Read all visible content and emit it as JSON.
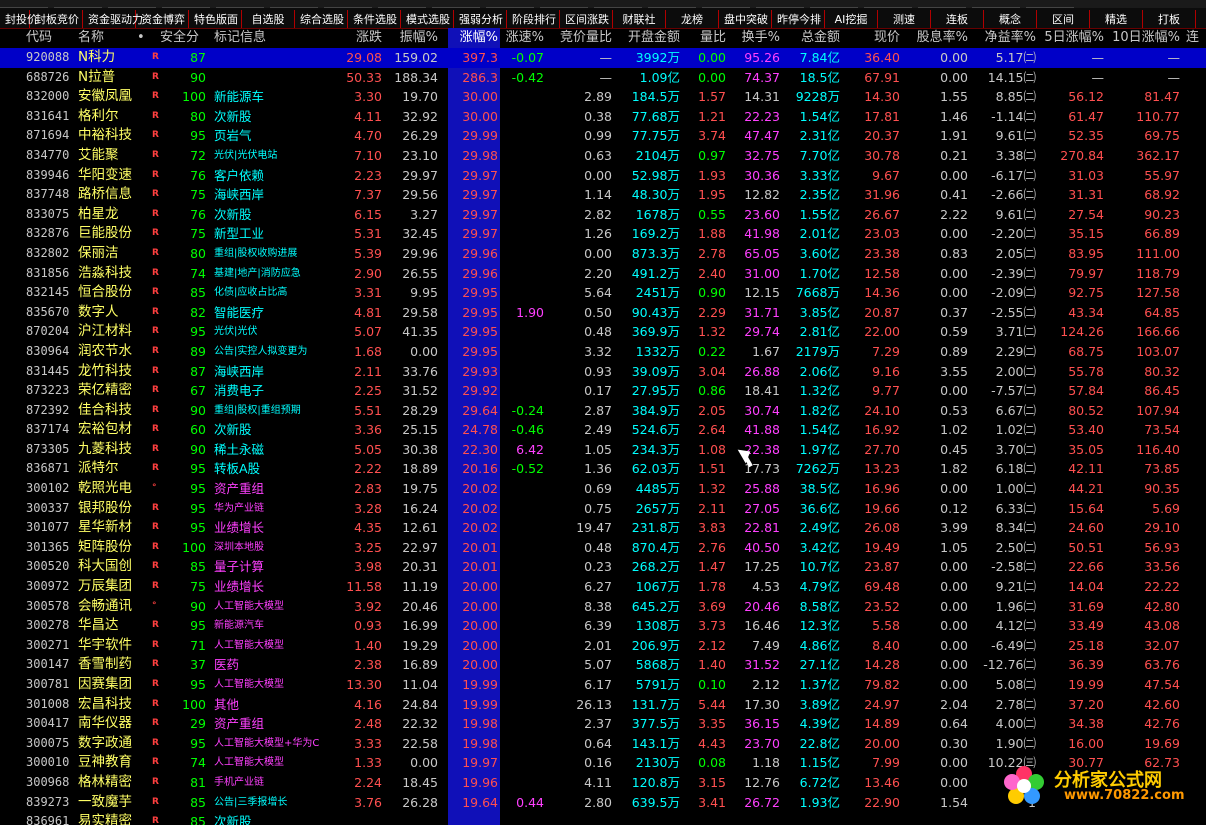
{
  "toolbar_count": 20,
  "tabs": [
    "封投价",
    "封板竞价",
    "资金驱动力",
    "资金博弈",
    "特色版面",
    "自选股",
    "综合选股",
    "条件选股",
    "模式选股",
    "强弱分析",
    "阶段排行",
    "区间涨跌",
    "财联社",
    "龙榜",
    "盘中突破",
    "昨停今排",
    "AI挖掘",
    "测速",
    "连板",
    "概念",
    "区间",
    "精选",
    "打板"
  ],
  "headers": {
    "code": "代码",
    "name": "名称",
    "star": "•",
    "score": "安全分",
    "tag": "标记信息",
    "chg": "涨跌",
    "amp": "振幅%",
    "pct": "涨幅%",
    "speed": "涨速%",
    "bidratio": "竞价量比",
    "openamt": "开盘金额",
    "volratio": "量比",
    "turn": "换手%",
    "total": "总金额",
    "price": "现价",
    "div": "股息率%",
    "pe": "净益率%",
    "d5": "5日涨幅%",
    "d10": "10日涨幅%",
    "extra": "连"
  },
  "rows": [
    {
      "code": "920088",
      "name": "N科力",
      "r": "R",
      "score": "87",
      "tag": "",
      "chg": "29.08",
      "amp": "159.02",
      "pct": "397.3",
      "speed": "-0.07",
      "bidratio": "—",
      "openamt": "3992万",
      "volratio": "0.00",
      "turn": "95.26",
      "total": "7.84亿",
      "price": "36.40",
      "div": "0.00",
      "pe": "5.17㈡",
      "d5": "—",
      "d10": "—"
    },
    {
      "code": "688726",
      "name": "N拉普",
      "r": "R",
      "score": "90",
      "tag": "",
      "chg": "50.33",
      "amp": "188.34",
      "pct": "286.3",
      "speed": "-0.42",
      "bidratio": "—",
      "openamt": "1.09亿",
      "volratio": "0.00",
      "turn": "74.37",
      "total": "18.5亿",
      "price": "67.91",
      "div": "0.00",
      "pe": "14.15㈡",
      "d5": "—",
      "d10": "—"
    },
    {
      "code": "832000",
      "name": "安徽凤凰",
      "r": "R",
      "score": "100",
      "tag": "新能源车",
      "chg": "3.30",
      "amp": "19.70",
      "pct": "30.00",
      "speed": "",
      "bidratio": "2.89",
      "openamt": "184.5万",
      "volratio": "1.57",
      "turn": "14.31",
      "total": "9228万",
      "price": "14.30",
      "div": "1.55",
      "pe": "8.85㈡",
      "d5": "56.12",
      "d10": "81.47"
    },
    {
      "code": "831641",
      "name": "格利尔",
      "r": "R",
      "score": "80",
      "tag": "次新股",
      "chg": "4.11",
      "amp": "32.92",
      "pct": "30.00",
      "speed": "",
      "bidratio": "0.38",
      "openamt": "77.68万",
      "volratio": "1.21",
      "turn": "22.23",
      "total": "1.54亿",
      "price": "17.81",
      "div": "1.46",
      "pe": "-1.14㈡",
      "d5": "61.47",
      "d10": "110.77"
    },
    {
      "code": "871694",
      "name": "中裕科技",
      "r": "R",
      "score": "95",
      "tag": "页岩气",
      "chg": "4.70",
      "amp": "26.29",
      "pct": "29.99",
      "speed": "",
      "bidratio": "0.99",
      "openamt": "77.75万",
      "volratio": "3.74",
      "turn": "47.47",
      "total": "2.31亿",
      "price": "20.37",
      "div": "1.91",
      "pe": "9.61㈡",
      "d5": "52.35",
      "d10": "69.75"
    },
    {
      "code": "834770",
      "name": "艾能聚",
      "r": "R",
      "score": "72",
      "tag": "光伏|光伏电站",
      "small": true,
      "chg": "7.10",
      "amp": "23.10",
      "pct": "29.98",
      "speed": "",
      "bidratio": "0.63",
      "openamt": "2104万",
      "volratio": "0.97",
      "turn": "32.75",
      "total": "7.70亿",
      "price": "30.78",
      "div": "0.21",
      "pe": "3.38㈡",
      "d5": "270.84",
      "d10": "362.17"
    },
    {
      "code": "839946",
      "name": "华阳变速",
      "r": "R",
      "score": "76",
      "tag": "客户依赖",
      "chg": "2.23",
      "amp": "29.97",
      "pct": "29.97",
      "speed": "",
      "bidratio": "0.00",
      "openamt": "52.98万",
      "volratio": "1.93",
      "turn": "30.36",
      "total": "3.33亿",
      "price": "9.67",
      "div": "0.00",
      "pe": "-6.17㈡",
      "d5": "31.03",
      "d10": "55.97"
    },
    {
      "code": "837748",
      "name": "路桥信息",
      "r": "R",
      "score": "75",
      "tag": "海峡西岸",
      "chg": "7.37",
      "amp": "29.56",
      "pct": "29.97",
      "speed": "",
      "bidratio": "1.14",
      "openamt": "48.30万",
      "volratio": "1.95",
      "turn": "12.82",
      "total": "2.35亿",
      "price": "31.96",
      "div": "0.41",
      "pe": "-2.66㈡",
      "d5": "31.31",
      "d10": "68.92"
    },
    {
      "code": "833075",
      "name": "柏星龙",
      "r": "R",
      "score": "76",
      "tag": "次新股",
      "chg": "6.15",
      "amp": "3.27",
      "pct": "29.97",
      "speed": "",
      "bidratio": "2.82",
      "openamt": "1678万",
      "volratio": "0.55",
      "turn": "23.60",
      "total": "1.55亿",
      "price": "26.67",
      "div": "2.22",
      "pe": "9.61㈡",
      "d5": "27.54",
      "d10": "90.23"
    },
    {
      "code": "832876",
      "name": "巨能股份",
      "r": "R",
      "score": "75",
      "tag": "新型工业",
      "chg": "5.31",
      "amp": "32.45",
      "pct": "29.97",
      "speed": "",
      "bidratio": "1.26",
      "openamt": "169.2万",
      "volratio": "1.88",
      "turn": "41.98",
      "total": "2.01亿",
      "price": "23.03",
      "div": "0.00",
      "pe": "-2.20㈡",
      "d5": "35.15",
      "d10": "66.89"
    },
    {
      "code": "832802",
      "name": "保丽洁",
      "r": "R",
      "score": "80",
      "tag": "重组|股权收购进展",
      "small": true,
      "chg": "5.39",
      "amp": "29.96",
      "pct": "29.96",
      "speed": "",
      "bidratio": "0.00",
      "openamt": "873.3万",
      "volratio": "2.78",
      "turn": "65.05",
      "total": "3.60亿",
      "price": "23.38",
      "div": "0.83",
      "pe": "2.05㈡",
      "d5": "83.95",
      "d10": "111.00"
    },
    {
      "code": "831856",
      "name": "浩淼科技",
      "r": "R",
      "score": "74",
      "tag": "基建|地产|消防应急",
      "small": true,
      "chg": "2.90",
      "amp": "26.55",
      "pct": "29.96",
      "speed": "",
      "bidratio": "2.20",
      "openamt": "491.2万",
      "volratio": "2.40",
      "turn": "31.00",
      "total": "1.70亿",
      "price": "12.58",
      "div": "0.00",
      "pe": "-2.39㈡",
      "d5": "79.97",
      "d10": "118.79"
    },
    {
      "code": "832145",
      "name": "恒合股份",
      "r": "R",
      "score": "85",
      "tag": "化债|应收占比高",
      "small": true,
      "chg": "3.31",
      "amp": "9.95",
      "pct": "29.95",
      "speed": "",
      "bidratio": "5.64",
      "openamt": "2451万",
      "volratio": "0.90",
      "turn": "12.15",
      "total": "7668万",
      "price": "14.36",
      "div": "0.00",
      "pe": "-2.09㈡",
      "d5": "92.75",
      "d10": "127.58"
    },
    {
      "code": "835670",
      "name": "数字人",
      "r": "R",
      "score": "82",
      "tag": "智能医疗",
      "chg": "4.81",
      "amp": "29.58",
      "pct": "29.95",
      "speed": "1.90",
      "bidratio": "0.50",
      "openamt": "90.43万",
      "volratio": "2.29",
      "turn": "31.71",
      "total": "3.85亿",
      "price": "20.87",
      "div": "0.37",
      "pe": "-2.55㈡",
      "d5": "43.34",
      "d10": "64.85"
    },
    {
      "code": "870204",
      "name": "沪江材料",
      "r": "R",
      "score": "95",
      "tag": "光伏|光伏",
      "small": true,
      "chg": "5.07",
      "amp": "41.35",
      "pct": "29.95",
      "speed": "",
      "bidratio": "0.48",
      "openamt": "369.9万",
      "volratio": "1.32",
      "turn": "29.74",
      "total": "2.81亿",
      "price": "22.00",
      "div": "0.59",
      "pe": "3.71㈡",
      "d5": "124.26",
      "d10": "166.66"
    },
    {
      "code": "830964",
      "name": "润农节水",
      "r": "R",
      "score": "89",
      "tag": "公告|实控人拟变更为",
      "small": true,
      "chg": "1.68",
      "amp": "0.00",
      "pct": "29.95",
      "speed": "",
      "bidratio": "3.32",
      "openamt": "1332万",
      "volratio": "0.22",
      "turn": "1.67",
      "total": "2179万",
      "price": "7.29",
      "div": "0.89",
      "pe": "2.29㈡",
      "d5": "68.75",
      "d10": "103.07"
    },
    {
      "code": "831445",
      "name": "龙竹科技",
      "r": "R",
      "score": "87",
      "tag": "海峡西岸",
      "chg": "2.11",
      "amp": "33.76",
      "pct": "29.93",
      "speed": "",
      "bidratio": "0.93",
      "openamt": "39.09万",
      "volratio": "3.04",
      "turn": "26.88",
      "total": "2.06亿",
      "price": "9.16",
      "div": "3.55",
      "pe": "2.00㈡",
      "d5": "55.78",
      "d10": "80.32"
    },
    {
      "code": "873223",
      "name": "荣亿精密",
      "r": "R",
      "score": "67",
      "tag": "消费电子",
      "chg": "2.25",
      "amp": "31.52",
      "pct": "29.92",
      "speed": "",
      "bidratio": "0.17",
      "openamt": "27.95万",
      "volratio": "0.86",
      "turn": "18.41",
      "total": "1.32亿",
      "price": "9.77",
      "div": "0.00",
      "pe": "-7.57㈡",
      "d5": "57.84",
      "d10": "86.45"
    },
    {
      "code": "872392",
      "name": "佳合科技",
      "r": "R",
      "score": "90",
      "tag": "重组|股权|重组预期",
      "small": true,
      "chg": "5.51",
      "amp": "28.29",
      "pct": "29.64",
      "speed": "-0.24",
      "bidratio": "2.87",
      "openamt": "384.9万",
      "volratio": "2.05",
      "turn": "30.74",
      "total": "1.82亿",
      "price": "24.10",
      "div": "0.53",
      "pe": "6.67㈡",
      "d5": "80.52",
      "d10": "107.94"
    },
    {
      "code": "837174",
      "name": "宏裕包材",
      "r": "R",
      "score": "60",
      "tag": "次新股",
      "chg": "3.36",
      "amp": "25.15",
      "pct": "24.78",
      "speed": "-0.46",
      "bidratio": "2.49",
      "openamt": "524.6万",
      "volratio": "2.64",
      "turn": "41.88",
      "total": "1.54亿",
      "price": "16.92",
      "div": "1.02",
      "pe": "1.02㈡",
      "d5": "53.40",
      "d10": "73.54"
    },
    {
      "code": "873305",
      "name": "九菱科技",
      "r": "R",
      "score": "90",
      "tag": "稀土永磁",
      "chg": "5.05",
      "amp": "30.38",
      "pct": "22.30",
      "speed": "6.42",
      "bidratio": "1.05",
      "openamt": "234.3万",
      "volratio": "1.08",
      "turn": "22.38",
      "total": "1.97亿",
      "price": "27.70",
      "div": "0.45",
      "pe": "3.70㈡",
      "d5": "35.05",
      "d10": "116.40"
    },
    {
      "code": "836871",
      "name": "派特尔",
      "r": "R",
      "score": "95",
      "tag": "转板A股",
      "chg": "2.22",
      "amp": "18.89",
      "pct": "20.16",
      "speed": "-0.52",
      "bidratio": "1.36",
      "openamt": "62.03万",
      "volratio": "1.51",
      "turn": "17.73",
      "total": "7262万",
      "price": "13.23",
      "div": "1.82",
      "pe": "6.18㈡",
      "d5": "42.11",
      "d10": "73.85"
    },
    {
      "code": "300102",
      "name": "乾照光电",
      "r": "°",
      "score": "95",
      "tag": "资产重组",
      "mag": true,
      "chg": "2.83",
      "amp": "19.75",
      "pct": "20.02",
      "speed": "",
      "bidratio": "0.69",
      "openamt": "4485万",
      "volratio": "1.32",
      "turn": "25.88",
      "total": "38.5亿",
      "price": "16.96",
      "div": "0.00",
      "pe": "1.00㈡",
      "d5": "44.21",
      "d10": "90.35"
    },
    {
      "code": "300337",
      "name": "银邦股份",
      "r": "R",
      "score": "95",
      "tag": "华为产业链",
      "mag": true,
      "small": true,
      "chg": "3.28",
      "amp": "16.24",
      "pct": "20.02",
      "speed": "",
      "bidratio": "0.75",
      "openamt": "2657万",
      "volratio": "2.11",
      "turn": "27.05",
      "total": "36.6亿",
      "price": "19.66",
      "div": "0.12",
      "pe": "6.33㈡",
      "d5": "15.64",
      "d10": "5.69"
    },
    {
      "code": "301077",
      "name": "星华新材",
      "r": "R",
      "score": "95",
      "tag": "业绩增长",
      "mag": true,
      "chg": "4.35",
      "amp": "12.61",
      "pct": "20.02",
      "speed": "",
      "bidratio": "19.47",
      "openamt": "231.8万",
      "volratio": "3.83",
      "turn": "22.81",
      "total": "2.49亿",
      "price": "26.08",
      "div": "3.99",
      "pe": "8.34㈡",
      "d5": "24.60",
      "d10": "29.10"
    },
    {
      "code": "301365",
      "name": "矩阵股份",
      "r": "R",
      "score": "100",
      "tag": "深圳本地股",
      "mag": true,
      "small": true,
      "chg": "3.25",
      "amp": "22.97",
      "pct": "20.01",
      "speed": "",
      "bidratio": "0.48",
      "openamt": "870.4万",
      "volratio": "2.76",
      "turn": "40.50",
      "total": "3.42亿",
      "price": "19.49",
      "div": "1.05",
      "pe": "2.50㈡",
      "d5": "50.51",
      "d10": "56.93"
    },
    {
      "code": "300520",
      "name": "科大国创",
      "r": "R",
      "score": "85",
      "tag": "量子计算",
      "mag": true,
      "chg": "3.98",
      "amp": "20.31",
      "pct": "20.01",
      "speed": "",
      "bidratio": "0.23",
      "openamt": "268.2万",
      "volratio": "1.47",
      "turn": "17.25",
      "total": "10.7亿",
      "price": "23.87",
      "div": "0.00",
      "pe": "-2.58㈡",
      "d5": "22.66",
      "d10": "33.56"
    },
    {
      "code": "300972",
      "name": "万辰集团",
      "r": "R",
      "score": "75",
      "tag": "业绩增长",
      "mag": true,
      "chg": "11.58",
      "amp": "11.19",
      "pct": "20.00",
      "speed": "",
      "bidratio": "6.27",
      "openamt": "1067万",
      "volratio": "1.78",
      "turn": "4.53",
      "total": "4.79亿",
      "price": "69.48",
      "div": "0.00",
      "pe": "9.21㈡",
      "d5": "14.04",
      "d10": "22.22"
    },
    {
      "code": "300578",
      "name": "会畅通讯",
      "r": "°",
      "score": "90",
      "tag": "人工智能大模型",
      "mag": true,
      "small": true,
      "chg": "3.92",
      "amp": "20.46",
      "pct": "20.00",
      "speed": "",
      "bidratio": "8.38",
      "openamt": "645.2万",
      "volratio": "3.69",
      "turn": "20.46",
      "total": "8.58亿",
      "price": "23.52",
      "div": "0.00",
      "pe": "1.96㈡",
      "d5": "31.69",
      "d10": "42.80"
    },
    {
      "code": "300278",
      "name": "华昌达",
      "r": "R",
      "score": "95",
      "tag": "新能源汽车",
      "mag": true,
      "small": true,
      "chg": "0.93",
      "amp": "16.99",
      "pct": "20.00",
      "speed": "",
      "bidratio": "6.39",
      "openamt": "1308万",
      "volratio": "3.73",
      "turn": "16.46",
      "total": "12.3亿",
      "price": "5.58",
      "div": "0.00",
      "pe": "4.12㈡",
      "d5": "33.49",
      "d10": "43.08"
    },
    {
      "code": "300271",
      "name": "华宇软件",
      "r": "R",
      "score": "71",
      "tag": "人工智能大模型",
      "mag": true,
      "small": true,
      "chg": "1.40",
      "amp": "19.29",
      "pct": "20.00",
      "speed": "",
      "bidratio": "2.01",
      "openamt": "206.9万",
      "volratio": "2.12",
      "turn": "7.49",
      "total": "4.86亿",
      "price": "8.40",
      "div": "0.00",
      "pe": "-6.49㈡",
      "d5": "25.18",
      "d10": "32.07"
    },
    {
      "code": "300147",
      "name": "香雪制药",
      "r": "R",
      "score": "37",
      "tag": "医药",
      "mag": true,
      "chg": "2.38",
      "amp": "16.89",
      "pct": "20.00",
      "speed": "",
      "bidratio": "5.07",
      "openamt": "5868万",
      "volratio": "1.40",
      "turn": "31.52",
      "total": "27.1亿",
      "price": "14.28",
      "div": "0.00",
      "pe": "-12.76㈡",
      "d5": "36.39",
      "d10": "63.76"
    },
    {
      "code": "300781",
      "name": "因赛集团",
      "r": "R",
      "score": "95",
      "tag": "人工智能大模型",
      "mag": true,
      "small": true,
      "chg": "13.30",
      "amp": "11.04",
      "pct": "19.99",
      "speed": "",
      "bidratio": "6.17",
      "openamt": "5791万",
      "volratio": "0.10",
      "turn": "2.12",
      "total": "1.37亿",
      "price": "79.82",
      "div": "0.00",
      "pe": "5.08㈡",
      "d5": "19.99",
      "d10": "47.54"
    },
    {
      "code": "301008",
      "name": "宏昌科技",
      "r": "R",
      "score": "100",
      "tag": "其他",
      "mag": true,
      "chg": "4.16",
      "amp": "24.84",
      "pct": "19.99",
      "speed": "",
      "bidratio": "26.13",
      "openamt": "131.7万",
      "volratio": "5.44",
      "turn": "17.30",
      "total": "3.89亿",
      "price": "24.97",
      "div": "2.04",
      "pe": "2.78㈡",
      "d5": "37.20",
      "d10": "42.60"
    },
    {
      "code": "300417",
      "name": "南华仪器",
      "r": "R",
      "score": "29",
      "tag": "资产重组",
      "mag": true,
      "chg": "2.48",
      "amp": "22.32",
      "pct": "19.98",
      "speed": "",
      "bidratio": "2.37",
      "openamt": "377.5万",
      "volratio": "3.35",
      "turn": "36.15",
      "total": "4.39亿",
      "price": "14.89",
      "div": "0.64",
      "pe": "4.00㈡",
      "d5": "34.38",
      "d10": "42.76"
    },
    {
      "code": "300075",
      "name": "数字政通",
      "r": "R",
      "score": "95",
      "tag": "人工智能大模型+华为C",
      "mag": true,
      "small": true,
      "chg": "3.33",
      "amp": "22.58",
      "pct": "19.98",
      "speed": "",
      "bidratio": "0.64",
      "openamt": "143.1万",
      "volratio": "4.43",
      "turn": "23.70",
      "total": "22.8亿",
      "price": "20.00",
      "div": "0.30",
      "pe": "1.90㈡",
      "d5": "16.00",
      "d10": "19.69"
    },
    {
      "code": "300010",
      "name": "豆神教育",
      "r": "R",
      "score": "74",
      "tag": "人工智能大模型",
      "mag": true,
      "small": true,
      "chg": "1.33",
      "amp": "0.00",
      "pct": "19.97",
      "speed": "",
      "bidratio": "0.16",
      "openamt": "2130万",
      "volratio": "0.08",
      "turn": "1.18",
      "total": "1.15亿",
      "price": "7.99",
      "div": "0.00",
      "pe": "10.22㈢",
      "d5": "30.77",
      "d10": "62.73"
    },
    {
      "code": "300968",
      "name": "格林精密",
      "r": "R",
      "score": "81",
      "tag": "手机产业链",
      "mag": true,
      "small": true,
      "chg": "2.24",
      "amp": "18.45",
      "pct": "19.96",
      "speed": "",
      "bidratio": "4.11",
      "openamt": "120.8万",
      "volratio": "3.15",
      "turn": "12.76",
      "total": "6.72亿",
      "price": "13.46",
      "div": "0.00",
      "pe": "4.45",
      "d5": "",
      "d10": ""
    },
    {
      "code": "839273",
      "name": "一致魔芋",
      "r": "R",
      "score": "85",
      "tag": "公告|三季报增长",
      "small": true,
      "chg": "3.76",
      "amp": "26.28",
      "pct": "19.64",
      "speed": "0.44",
      "bidratio": "2.80",
      "openamt": "639.5万",
      "volratio": "3.41",
      "turn": "26.72",
      "total": "1.93亿",
      "price": "22.90",
      "div": "1.54",
      "pe": "1",
      "d5": "",
      "d10": ""
    },
    {
      "code": "836961",
      "name": "易实精密",
      "r": "R",
      "score": "85",
      "tag": "次新股",
      "chg": "",
      "amp": "",
      "pct": "",
      "speed": "",
      "bidratio": "",
      "openamt": "",
      "volratio": "",
      "turn": "",
      "total": "",
      "price": "",
      "div": "",
      "pe": "",
      "d5": "",
      "d10": ""
    }
  ],
  "logo": {
    "site": "分析家公式网",
    "url": "www.70822.com"
  }
}
